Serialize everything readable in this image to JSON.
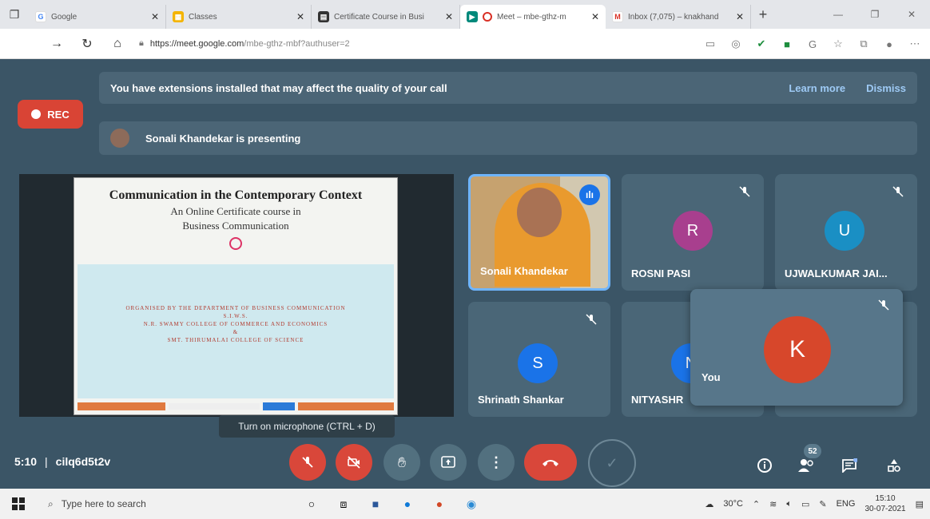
{
  "browser": {
    "tabs": [
      {
        "title": "Google",
        "icon": "google-icon"
      },
      {
        "title": "Classes",
        "icon": "classroom-icon"
      },
      {
        "title": "Certificate Course in Busi",
        "icon": "doc-icon"
      },
      {
        "title": "Meet – mbe-gthz-m",
        "icon": "meet-icon"
      },
      {
        "title": "Inbox (7,075) – knakhand",
        "icon": "gmail-icon"
      }
    ],
    "url_host": "https://meet.google.com",
    "url_path": "/mbe-gthz-mbf?authuser=2"
  },
  "meet": {
    "banner_text": "You have extensions installed that may affect the quality of your call",
    "learn_more": "Learn more",
    "dismiss": "Dismiss",
    "rec_label": "REC",
    "presenting_text": "Sonali Khandekar is presenting",
    "slide": {
      "title": "Communication in the Contemporary Context",
      "subtitle_1": "An Online Certificate course in",
      "subtitle_2": "Business Communication",
      "org_1": "ORGANISED BY THE DEPARTMENT OF BUSINESS COMMUNICATION",
      "org_2": "S.I.W.S.",
      "org_3": "N.R. SWAMY COLLEGE OF COMMERCE AND ECONOMICS",
      "org_4": "&",
      "org_5": "SMT. THIRUMALAI COLLEGE OF SCIENCE"
    },
    "participants": [
      {
        "name": "Sonali Khandekar"
      },
      {
        "name": "ROSNI PASI",
        "initial": "R",
        "color": "#a83f8e"
      },
      {
        "name": "UJWALKUMAR JAI...",
        "initial": "U",
        "color": "#1a8fc4"
      },
      {
        "name": "Shrinath Shankar",
        "initial": "S",
        "color": "#1a73e8"
      },
      {
        "name": "NITYASHR",
        "initial": "N",
        "color": "#1a73e8"
      }
    ],
    "you": {
      "name": "You",
      "initial": "K",
      "color": "#d7472b"
    },
    "tooltip": "Turn on microphone (CTRL + D)",
    "time": "5:10",
    "meeting_code": "cilq6d5t2v",
    "participant_count": "52"
  },
  "taskbar": {
    "search_placeholder": "Type here to search",
    "temperature": "30°C",
    "language": "ENG",
    "time": "15:10",
    "date": "30-07-2021"
  }
}
